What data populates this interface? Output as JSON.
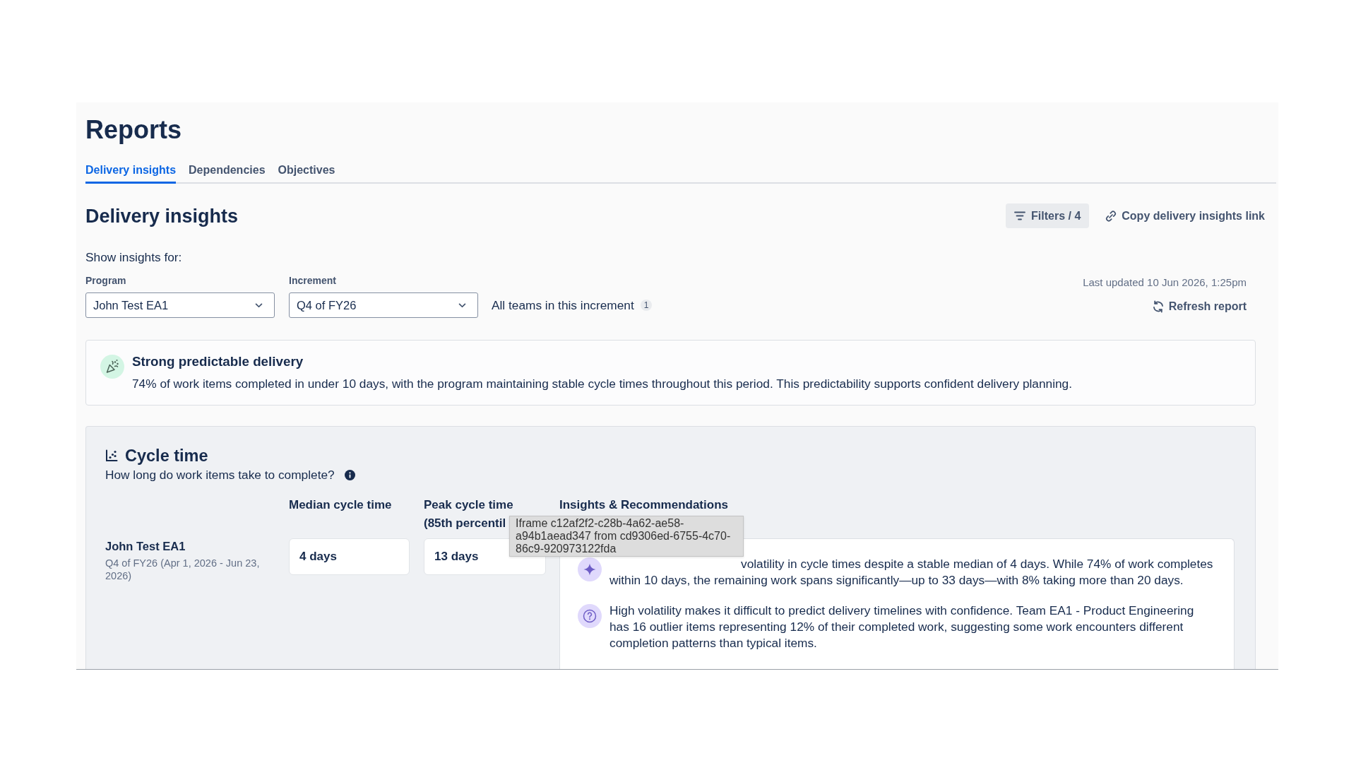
{
  "page": {
    "title": "Reports"
  },
  "tabs": [
    {
      "label": "Delivery insights",
      "selected": true
    },
    {
      "label": "Dependencies",
      "selected": false
    },
    {
      "label": "Objectives",
      "selected": false
    }
  ],
  "section": {
    "title": "Delivery insights",
    "actions": [
      {
        "kind": "filter",
        "label": "Filters / 4"
      },
      {
        "kind": "link",
        "label": "Copy delivery insights link"
      }
    ]
  },
  "filters": {
    "intro": "Show insights for:",
    "fields": [
      {
        "label": "Program",
        "value": "John Test EA1"
      },
      {
        "label": "Increment",
        "value": "Q4 of FY26"
      }
    ],
    "teams": {
      "label": "All teams in this increment",
      "count": "1"
    },
    "last_updated": "Last updated 10 Jun 2026, 1:25pm",
    "refresh": "Refresh report"
  },
  "highlight": {
    "title": "Strong predictable delivery",
    "text": "74% of work items completed in under 10 days, with the program maintaining stable cycle times throughout this period. This predictability supports confident delivery planning."
  },
  "cycle_time": {
    "title": "Cycle time",
    "question": "How long do work items take to complete?",
    "columns": [
      "Median cycle time",
      "Peak cycle time (85th percentil",
      "Insights & Recommendations"
    ],
    "rows": [
      {
        "name": "John Test EA1",
        "period": "Q4 of FY26 (Apr 1, 2026 - Jun 23, 2026)",
        "median": "4 days",
        "peak": "13 days",
        "insights": [
          {
            "kind": "sparkle",
            "text": "volatility in cycle times despite a stable median of 4 days. While 74% of work completes within 10 days, the remaining work spans significantly—up to 33 days—with 8% taking more than 20 days."
          },
          {
            "kind": "question",
            "text": "High volatility makes it difficult to predict delivery timelines with confidence. Team EA1 - Product Engineering has 16 outlier items representing 12% of their completed work, suggesting some work encounters different completion patterns than typical items."
          }
        ]
      }
    ]
  },
  "tooltip": {
    "text": "Iframe c12af2f2-c28b-4a62-ae58-a94b1aead347 from cd9306ed-6755-4c70-86c9-920973122fda"
  }
}
